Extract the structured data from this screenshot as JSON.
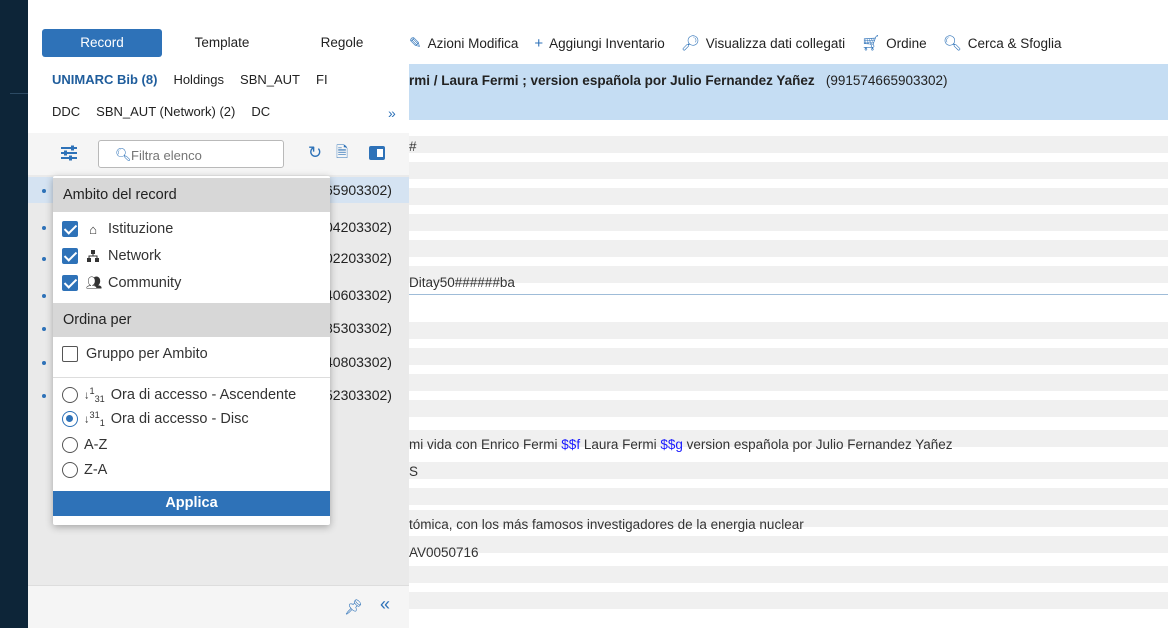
{
  "sidebar": {
    "tabs": [
      "Record",
      "Template",
      "Regole"
    ],
    "sub_tabs_row1": [
      "UNIMARC Bib (8)",
      "Holdings",
      "SBN_AUT",
      "FI"
    ],
    "sub_tabs_row2": [
      "DDC",
      "SBN_AUT (Network) (2)",
      "DC"
    ],
    "search_placeholder": "Filtra elenco",
    "list": [
      "65903302)",
      "04203302)",
      "02203302)",
      "40603302)",
      "85303302)",
      "40803302)",
      "52303302)"
    ]
  },
  "dropdown": {
    "scope_header": "Ambito del record",
    "scope_items": [
      "Istituzione",
      "Network",
      "Community"
    ],
    "sort_header": "Ordina per",
    "group_label": "Gruppo per Ambito",
    "sort_options": [
      "Ora di accesso - Ascendente",
      "Ora di accesso - Disc",
      "A-Z",
      "Z-A"
    ],
    "sort_asc_index": "1",
    "sort_asc_sub": "31",
    "sort_desc_index": "31",
    "sort_desc_sub": "1",
    "apply_label": "Applica"
  },
  "toolbar": {
    "actions": [
      "Azioni Modifica",
      "Aggiungi Inventario",
      "Visualizza dati collegati",
      "Ordine",
      "Cerca & Sfoglia"
    ]
  },
  "record": {
    "title_bold": "rmi / Laura Fermi ; version española por Julio Fernandez Yañez",
    "title_id": "(991574665903302)"
  },
  "fields": {
    "f1": "#",
    "f2": "Ditay50######ba",
    "f3_a": "mi vida con Enrico Fermi ",
    "f3_sub1": "$$f",
    "f3_b": " Laura Fermi ",
    "f3_sub2": "$$g",
    "f3_c": " version española por Julio Fernandez Yañez",
    "f4": "S",
    "f5": "tómica, con los más famosos investigadores de la energia nuclear",
    "f6": "AV0050716"
  }
}
